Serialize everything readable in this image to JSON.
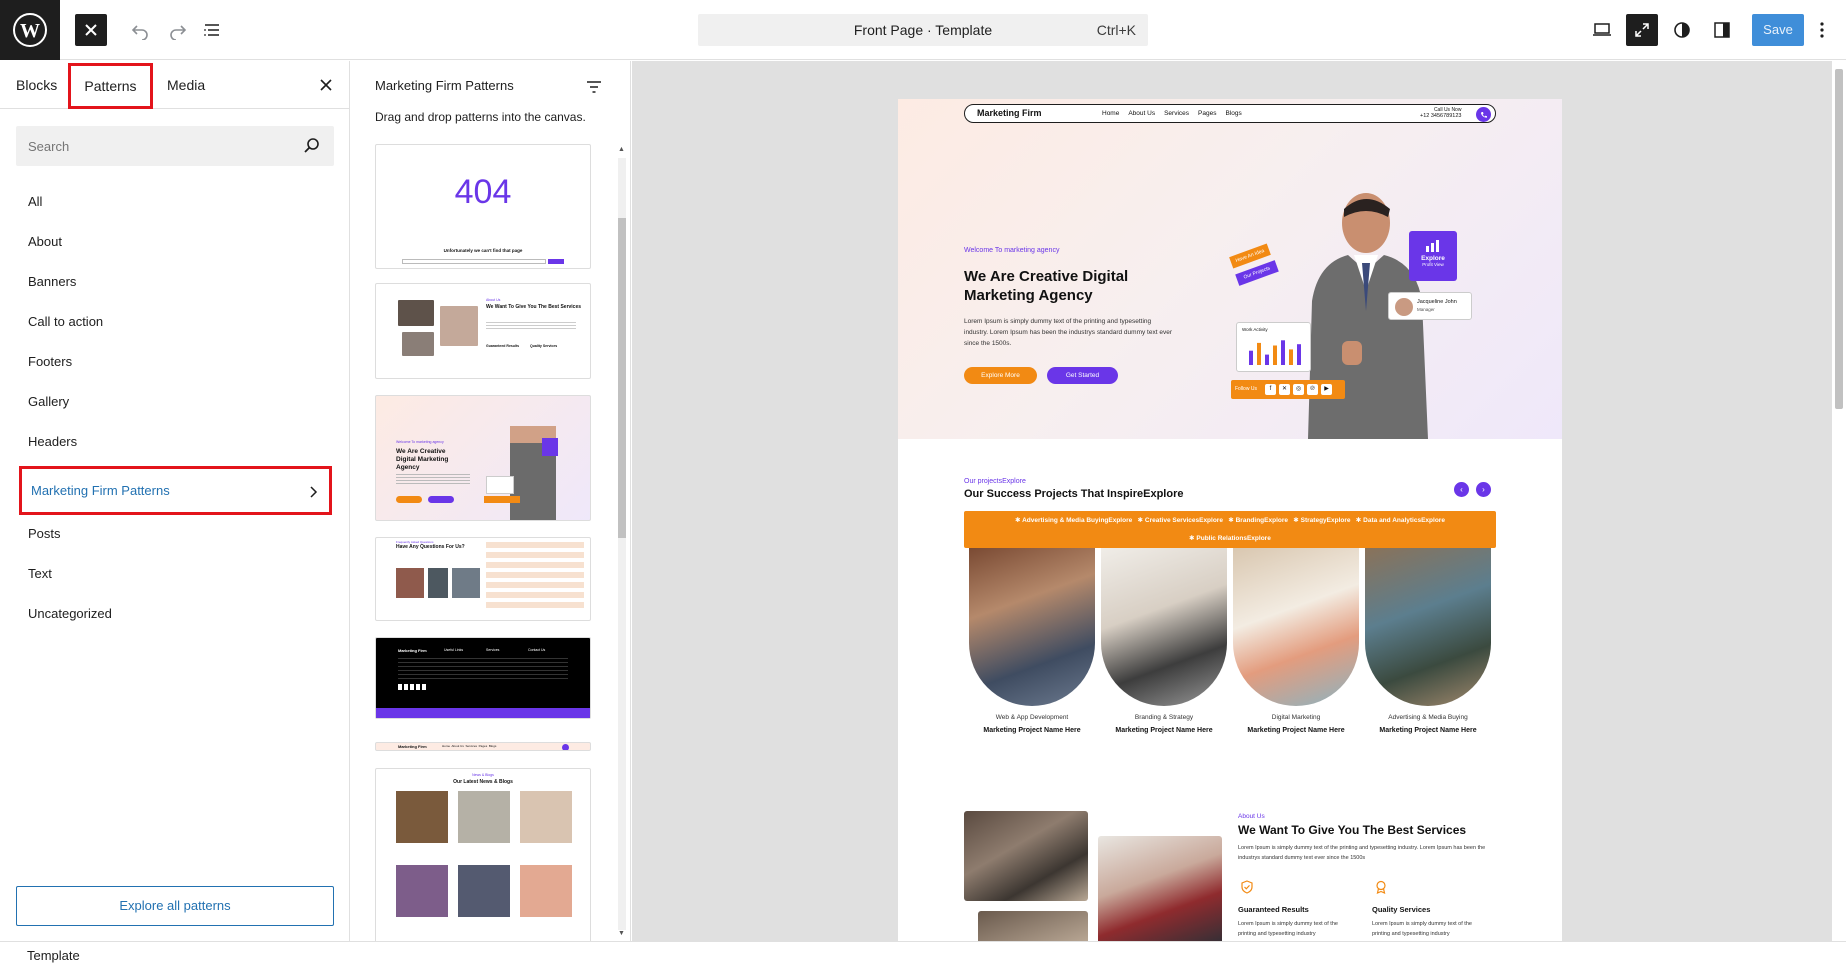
{
  "topbar": {
    "document_title": "Front Page · Template",
    "shortcut": "Ctrl+K",
    "save_label": "Save"
  },
  "inserter": {
    "tabs": [
      "Blocks",
      "Patterns",
      "Media"
    ],
    "active_tab": "Patterns",
    "search_placeholder": "Search",
    "categories": [
      "All",
      "About",
      "Banners",
      "Call to action",
      "Footers",
      "Gallery",
      "Headers",
      "Marketing Firm Patterns",
      "Posts",
      "Text",
      "Uncategorized"
    ],
    "selected_category": "Marketing Firm Patterns",
    "explore_label": "Explore all patterns"
  },
  "patterns_panel": {
    "title": "Marketing Firm Patterns",
    "description": "Drag and drop patterns into the canvas.",
    "p404": {
      "code": "404",
      "msg": "Unfortunately we can't find that page"
    },
    "p_services": {
      "kicker": "About Us",
      "title": "We Want To Give You The Best Services",
      "col1": "Guaranteed Results",
      "col2": "Quality Services"
    },
    "p_hero": {
      "kicker": "Welcome To marketing agency",
      "title": "We Are Creative Digital Marketing Agency"
    },
    "p_faq": {
      "kicker": "Frequently Asked Questions",
      "title": "Have Any Questions For Us?"
    },
    "p_footer": {
      "brand": "Marketing Firm",
      "c1": "Useful Links",
      "c2": "Services",
      "c3": "Contact Us"
    },
    "p_header": {
      "brand": "Marketing Firm",
      "menu": "Home  About Us  Services  Pages  Blogs"
    },
    "p_blog": {
      "kicker": "News & Blogs",
      "title": "Our Latest News & Blogs"
    }
  },
  "site": {
    "logo": "Marketing Firm",
    "menu": [
      "Home",
      "About Us",
      "Services",
      "Pages",
      "Blogs"
    ],
    "call_label": "Call Us Now",
    "phone": "+12 3456789123",
    "hero": {
      "kicker": "Welcome To marketing agency",
      "title": "We Are Creative Digital Marketing Agency",
      "text": "Lorem Ipsum is simply dummy text of the printing and typesetting industry. Lorem Ipsum has been the industrys standard dummy text ever since the 1500s.",
      "btn_explore": "Explore More",
      "btn_start": "Get Started",
      "tag_idea": "Have An Idea",
      "tag_projects": "Our Projects",
      "badge_title": "Explore",
      "badge_sub": "Profit View",
      "person_name": "Jacqueline John",
      "person_role": "Manager",
      "work_label": "Work Activity",
      "follow_label": "Follow Us",
      "work_bars": [
        0.55,
        0.85,
        0.4,
        0.75,
        0.95,
        0.6,
        0.8
      ]
    },
    "projects": {
      "kicker": "Our projectsExplore",
      "title": "Our Success Projects That InspireExplore",
      "tags_line1": "✱ Advertising & Media BuyingExplore   ✱ Creative ServicesExplore   ✱ BrandingExplore   ✱ StrategyExplore   ✱ Data and AnalyticsExplore",
      "tags_line2": "✱ Public RelationsExplore",
      "items": [
        {
          "category": "Web & App Development",
          "name": "Marketing Project Name Here"
        },
        {
          "category": "Branding & Strategy",
          "name": "Marketing Project Name Here"
        },
        {
          "category": "Digital Marketing",
          "name": "Marketing Project Name Here"
        },
        {
          "category": "Advertising & Media Buying",
          "name": "Marketing Project Name Here"
        }
      ]
    },
    "about": {
      "kicker": "About Us",
      "title": "We Want To Give You The Best Services",
      "text": "Lorem Ipsum is simply dummy text of the printing and typesetting industry. Lorem Ipsum has been the industrys standard dummy text ever since the 1500s",
      "svc1_title": "Guaranteed Results",
      "svc1_text": "Lorem Ipsum is simply dummy text of the printing and typesetting industry",
      "svc2_title": "Quality Services",
      "svc2_text": "Lorem Ipsum is simply dummy text of the printing and typesetting industry"
    }
  },
  "footer": {
    "label": "Template"
  },
  "colors": {
    "purple": "#6a36e8",
    "orange": "#f28a13",
    "highlight": "#e3141b",
    "wp_blue": "#2271b1"
  }
}
